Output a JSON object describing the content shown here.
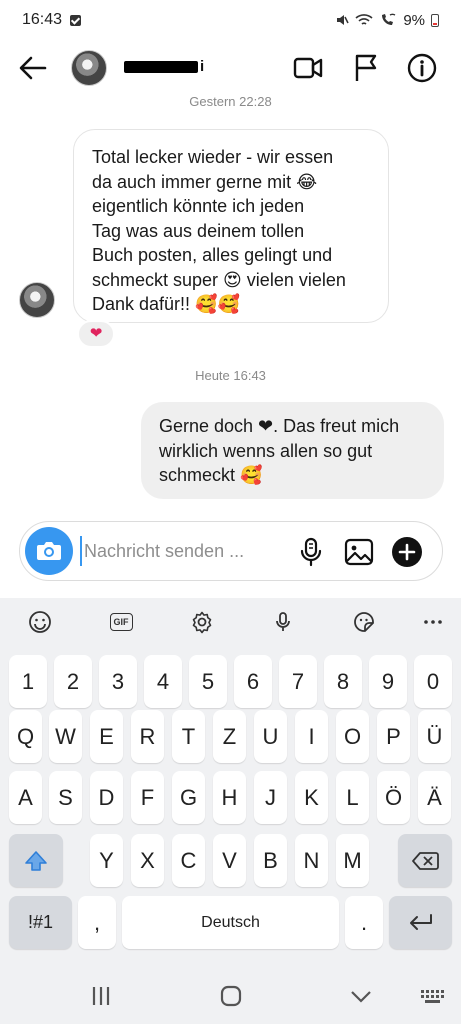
{
  "status_bar": {
    "time": "16:43",
    "battery": "9%"
  },
  "header": {
    "contact_name_visible": "i"
  },
  "chat": {
    "timestamp_1": "Gestern 22:28",
    "incoming_message_lines": [
      "Total lecker wieder - wir essen",
      "da auch immer gerne mit 😂",
      "eigentlich könnte ich jeden",
      "Tag was aus deinem tollen",
      "Buch posten, alles gelingt und",
      "schmeckt super 😍 vielen vielen",
      "Dank dafür!! 🥰🥰"
    ],
    "reaction": "❤",
    "timestamp_2": "Heute 16:43",
    "outgoing_message_lines": [
      "Gerne doch ❤. Das freut mich",
      "wirklich wenns allen so gut",
      "schmeckt 🥰"
    ]
  },
  "composer": {
    "placeholder": "Nachricht senden ..."
  },
  "keyboard": {
    "row_numbers": [
      "1",
      "2",
      "3",
      "4",
      "5",
      "6",
      "7",
      "8",
      "9",
      "0"
    ],
    "row_1": [
      "Q",
      "W",
      "E",
      "R",
      "T",
      "Z",
      "U",
      "I",
      "O",
      "P",
      "Ü"
    ],
    "row_2": [
      "A",
      "S",
      "D",
      "F",
      "G",
      "H",
      "J",
      "K",
      "L",
      "Ö",
      "Ä"
    ],
    "row_3": [
      "Y",
      "X",
      "C",
      "V",
      "B",
      "N",
      "M"
    ],
    "symbols_key": "!#1",
    "comma_key": ",",
    "space_label": "Deutsch",
    "period_key": ".",
    "gif_label": "GIF"
  },
  "colors": {
    "accent": "#3797f0",
    "heart": "#e0245e",
    "outgoing_bubble": "#efefef",
    "keyboard_bg": "#f0f1f3"
  }
}
